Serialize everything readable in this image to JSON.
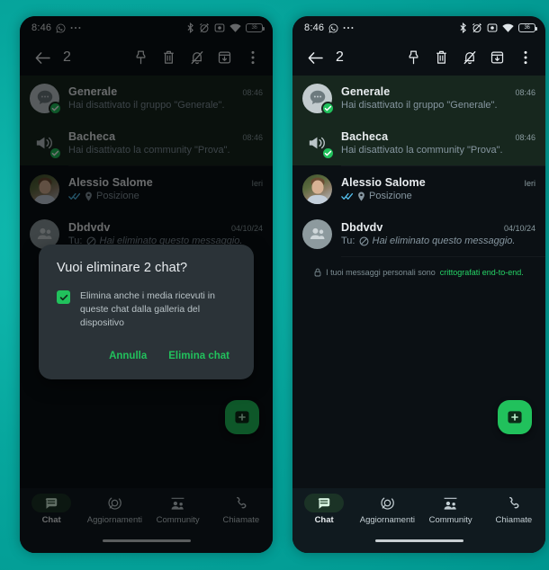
{
  "wallpaper": {
    "color": "#07a79e"
  },
  "accent": {
    "green": "#21c15c",
    "link_green": "#25d366",
    "selected_row_bg": "#17271e"
  },
  "panels": [
    {
      "id": "left",
      "status_bar": {
        "clock": "8:46",
        "left_icons": [
          "whatsapp-icon",
          "more-dots-icon"
        ],
        "right_icons": [
          "bluetooth-icon",
          "alarm-off-icon",
          "camera-icon",
          "wifi-icon",
          "battery-icon"
        ],
        "battery_level": "36"
      },
      "toolbar": {
        "back_label": "back-arrow",
        "selected_count": "2",
        "actions": [
          "pin-icon",
          "delete-icon",
          "mute-icon",
          "archive-icon",
          "overflow-menu-icon"
        ]
      },
      "chats": [
        {
          "name": "Generale",
          "preview": "Hai disattivato il gruppo \"Generale\".",
          "time": "08:46",
          "avatar": "group-chat-icon",
          "selected": true,
          "checked": true,
          "status_icon": "",
          "prefix": ""
        },
        {
          "name": "Bacheca",
          "preview": "Hai disattivato la community \"Prova\".",
          "time": "08:46",
          "avatar": "megaphone-icon",
          "selected": true,
          "checked": true,
          "status_icon": "",
          "prefix": ""
        },
        {
          "name": "Alessio Salome",
          "preview": "Posizione",
          "time": "Ieri",
          "avatar": "photo-avatar",
          "selected": false,
          "checked": false,
          "status_icon": "double-check-icon",
          "location_icon": "location-pin-icon",
          "prefix": ""
        },
        {
          "name": "Dbdvdv",
          "preview": "Hai eliminato questo messaggio.",
          "time": "04/10/24",
          "avatar": "group-people-icon",
          "selected": false,
          "checked": false,
          "status_icon": "blocked-icon",
          "prefix": "Tu:"
        }
      ],
      "encryption_notice": {
        "visible": false,
        "prefix": "I tuoi messaggi personali sono",
        "link": "crittografati end-to-end."
      },
      "dialog": {
        "visible": true,
        "title": "Vuoi eliminare 2 chat?",
        "checkbox_checked": true,
        "checkbox_label": "Elimina anche i media ricevuti in queste chat dalla galleria del dispositivo",
        "cancel_label": "Annulla",
        "confirm_label": "Elimina chat"
      },
      "fab": {
        "icon": "new-chat-icon"
      },
      "bottom_nav": {
        "active_index": 0,
        "items": [
          {
            "label": "Chat",
            "icon": "chats-icon"
          },
          {
            "label": "Aggiornamenti",
            "icon": "updates-icon"
          },
          {
            "label": "Community",
            "icon": "community-icon"
          },
          {
            "label": "Chiamate",
            "icon": "calls-icon"
          }
        ]
      }
    },
    {
      "id": "right",
      "status_bar": {
        "clock": "8:46",
        "left_icons": [
          "whatsapp-icon",
          "more-dots-icon"
        ],
        "right_icons": [
          "bluetooth-icon",
          "alarm-off-icon",
          "camera-icon",
          "wifi-icon",
          "battery-icon"
        ],
        "battery_level": "36"
      },
      "toolbar": {
        "back_label": "back-arrow",
        "selected_count": "2",
        "actions": [
          "pin-icon",
          "delete-icon",
          "mute-icon",
          "archive-icon",
          "overflow-menu-icon"
        ]
      },
      "chats": [
        {
          "name": "Generale",
          "preview": "Hai disattivato il gruppo \"Generale\".",
          "time": "08:46",
          "avatar": "group-chat-icon",
          "selected": true,
          "checked": true,
          "status_icon": "",
          "prefix": ""
        },
        {
          "name": "Bacheca",
          "preview": "Hai disattivato la community \"Prova\".",
          "time": "08:46",
          "avatar": "megaphone-icon",
          "selected": true,
          "checked": true,
          "status_icon": "",
          "prefix": ""
        },
        {
          "name": "Alessio Salome",
          "preview": "Posizione",
          "time": "Ieri",
          "avatar": "photo-avatar",
          "selected": false,
          "checked": false,
          "status_icon": "double-check-icon",
          "location_icon": "location-pin-icon",
          "prefix": ""
        },
        {
          "name": "Dbdvdv",
          "preview": "Hai eliminato questo messaggio.",
          "time": "04/10/24",
          "avatar": "group-people-icon",
          "selected": false,
          "checked": false,
          "status_icon": "blocked-icon",
          "prefix": "Tu:"
        }
      ],
      "encryption_notice": {
        "visible": true,
        "prefix": "I tuoi messaggi personali sono",
        "link": "crittografati end-to-end."
      },
      "dialog": {
        "visible": false
      },
      "fab": {
        "icon": "new-chat-icon"
      },
      "bottom_nav": {
        "active_index": 0,
        "items": [
          {
            "label": "Chat",
            "icon": "chats-icon"
          },
          {
            "label": "Aggiornamenti",
            "icon": "updates-icon"
          },
          {
            "label": "Community",
            "icon": "community-icon"
          },
          {
            "label": "Chiamate",
            "icon": "calls-icon"
          }
        ]
      }
    }
  ]
}
